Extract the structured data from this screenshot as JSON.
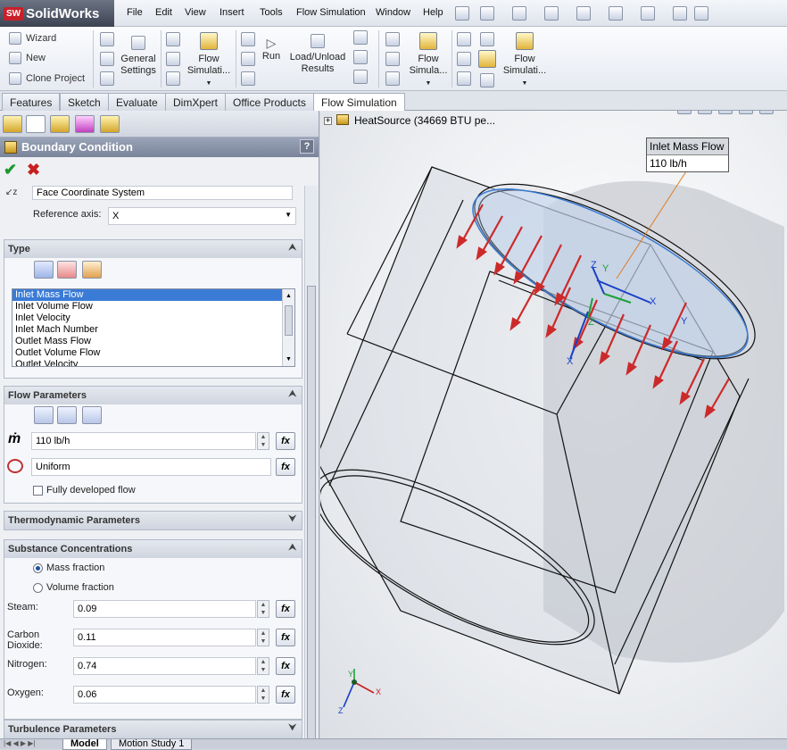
{
  "app": {
    "brand": "SolidWorks",
    "logo_mark": "SW"
  },
  "menu": [
    "File",
    "Edit",
    "View",
    "Insert",
    "Tools",
    "Flow Simulation",
    "Window",
    "Help"
  ],
  "command_manager": {
    "wizard": "Wizard",
    "new": "New",
    "clone_project": "Clone Project",
    "general_settings_1": "General",
    "general_settings_2": "Settings",
    "flow_sim_1a": "Flow",
    "flow_sim_1b": "Simulati...",
    "run": "Run",
    "load_unload_1": "Load/Unload",
    "load_unload_2": "Results",
    "flow_sim_2a": "Flow",
    "flow_sim_2b": "Simula...",
    "flow_sim_3a": "Flow",
    "flow_sim_3b": "Simulati..."
  },
  "tabs": [
    "Features",
    "Sketch",
    "Evaluate",
    "DimXpert",
    "Office Products",
    "Flow Simulation"
  ],
  "panel": {
    "title": "Boundary Condition",
    "help": "?",
    "coord_system": "Face Coordinate System",
    "reference_axis_label": "Reference axis:",
    "reference_axis_value": "X",
    "type_header": "Type",
    "type_options": [
      "Inlet Mass Flow",
      "Inlet Volume Flow",
      "Inlet Velocity",
      "Inlet Mach Number",
      "Outlet Mass Flow",
      "Outlet Volume Flow",
      "Outlet Velocity"
    ],
    "flow_params_header": "Flow Parameters",
    "mass_flow_symbol": "ṁ",
    "mass_flow_value": "110 lb/h",
    "profile_value": "Uniform",
    "fully_developed": "Fully developed flow",
    "fx": "fx",
    "thermo_header": "Thermodynamic Parameters",
    "substance_header": "Substance Concentrations",
    "mass_fraction": "Mass fraction",
    "volume_fraction": "Volume fraction",
    "steam_label": "Steam:",
    "steam_value": "0.09",
    "co2_label_1": "Carbon",
    "co2_label_2": "Dioxide:",
    "co2_value": "0.11",
    "nitrogen_label": "Nitrogen:",
    "nitrogen_value": "0.74",
    "oxygen_label": "Oxygen:",
    "oxygen_value": "0.06",
    "turbulence_header": "Turbulence Parameters"
  },
  "viewport": {
    "tree_item": "HeatSource  (34669 BTU pe...",
    "tree_expander": "+",
    "annotation_title": "Inlet Mass Flow",
    "annotation_value": "110 lb/h",
    "axis_x": "X",
    "axis_y": "Y",
    "axis_z": "Z"
  },
  "bottom_tabs": [
    "Model",
    "Motion Study 1"
  ],
  "colors": {
    "accent": "#3a7bd5",
    "arrow": "#cc2a2a",
    "panel_header": "#8a94a8"
  }
}
